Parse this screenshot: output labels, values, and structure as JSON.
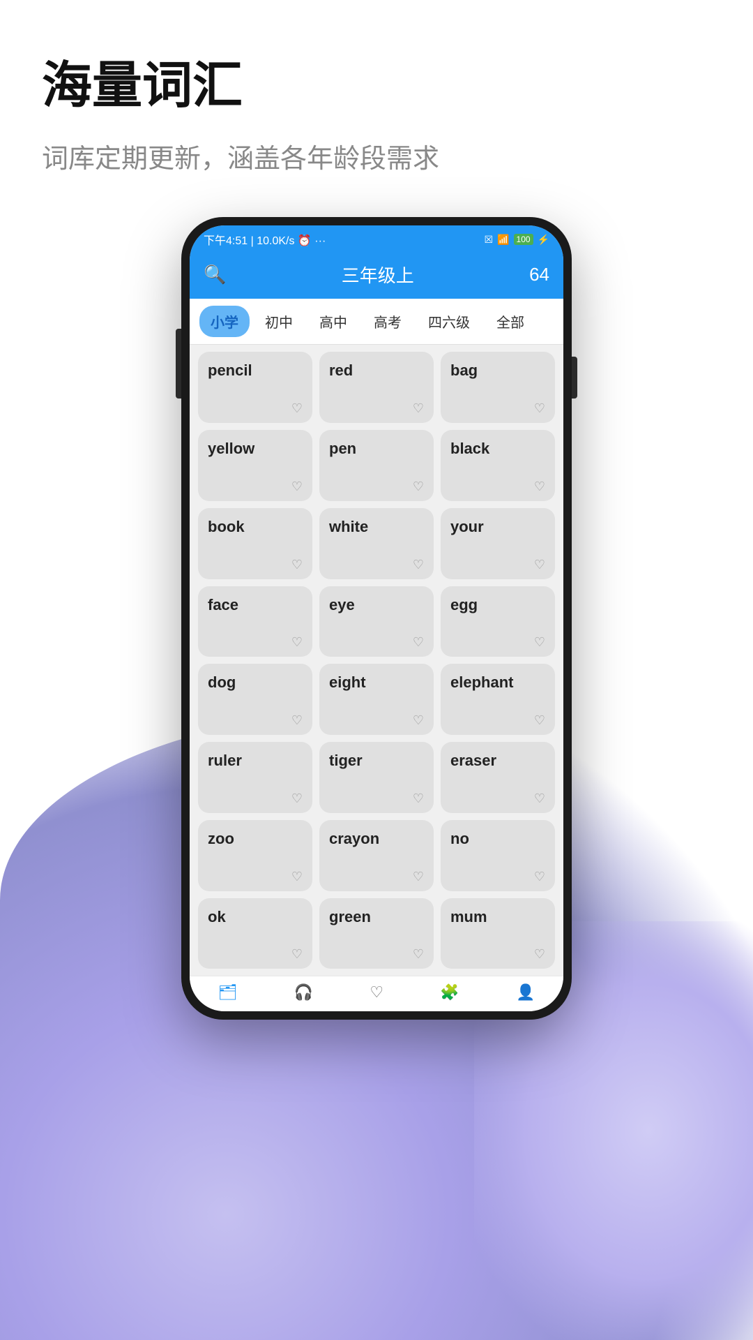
{
  "page": {
    "main_title": "海量词汇",
    "sub_title": "词库定期更新，涵盖各年龄段需求"
  },
  "status_bar": {
    "time": "下午4:51",
    "network": "10.0K/s",
    "battery": "100",
    "icons": "⏰ ···"
  },
  "header": {
    "title": "三年级上",
    "count": "64",
    "search_icon": "🔍"
  },
  "filter_tabs": [
    {
      "label": "小学",
      "active": true
    },
    {
      "label": "初中",
      "active": false
    },
    {
      "label": "高中",
      "active": false
    },
    {
      "label": "高考",
      "active": false
    },
    {
      "label": "四六级",
      "active": false
    },
    {
      "label": "全部",
      "active": false
    }
  ],
  "words": [
    "pencil",
    "red",
    "bag",
    "yellow",
    "pen",
    "black",
    "book",
    "white",
    "your",
    "face",
    "eye",
    "egg",
    "dog",
    "eight",
    "elephant",
    "ruler",
    "tiger",
    "eraser",
    "zoo",
    "crayon",
    "no",
    "ok",
    "green",
    "mum"
  ],
  "bottom_nav": [
    {
      "icon": "📖",
      "label": "词库",
      "active": true
    },
    {
      "icon": "🎧",
      "label": "听力",
      "active": false
    },
    {
      "icon": "♡",
      "label": "收藏",
      "active": false
    },
    {
      "icon": "🧩",
      "label": "练习",
      "active": false
    },
    {
      "icon": "👤",
      "label": "我的",
      "active": false
    }
  ]
}
